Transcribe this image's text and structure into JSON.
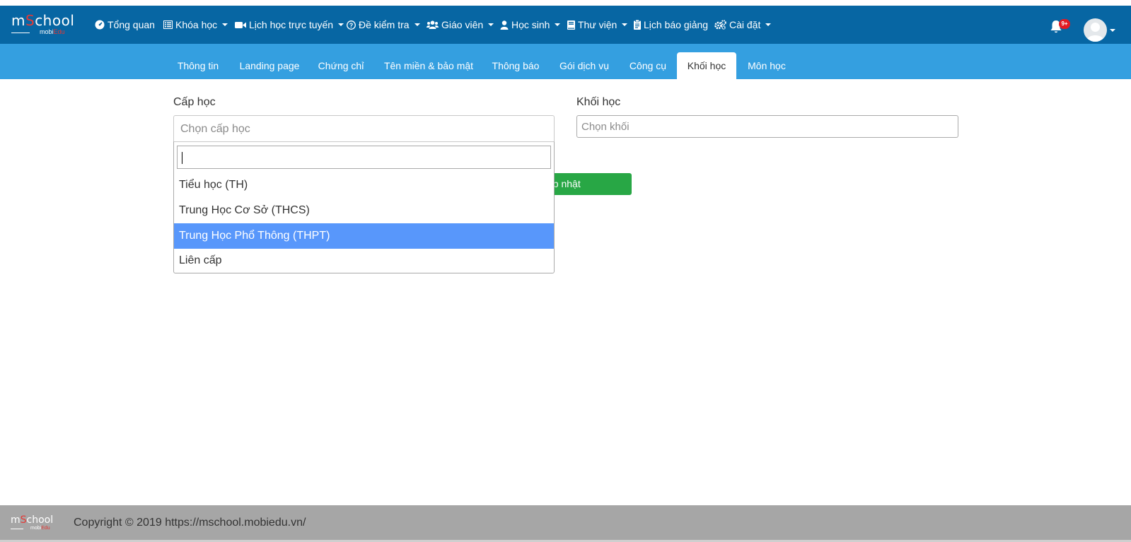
{
  "brand": {
    "logo_main": "mSchool",
    "logo_sub": "mobiEdu"
  },
  "nav": {
    "items": [
      {
        "label": "Tổng quan",
        "icon": "dashboard-icon",
        "dropdown": false
      },
      {
        "label": "Khóa học",
        "icon": "list-icon",
        "dropdown": true
      },
      {
        "label": "Lịch học trực tuyến",
        "icon": "video-icon",
        "dropdown": true
      },
      {
        "label": "Đề kiểm tra",
        "icon": "question-icon",
        "dropdown": true
      },
      {
        "label": "Giáo viên",
        "icon": "users-icon",
        "dropdown": true
      },
      {
        "label": "Học sinh",
        "icon": "user-icon",
        "dropdown": true
      },
      {
        "label": "Thư viện",
        "icon": "book-icon",
        "dropdown": true
      },
      {
        "label": "Lịch báo giảng",
        "icon": "clipboard-icon",
        "dropdown": false
      },
      {
        "label": "Cài đặt",
        "icon": "gears-icon",
        "dropdown": true
      }
    ],
    "notification_badge": "9+"
  },
  "tabs": [
    {
      "label": "Thông tin"
    },
    {
      "label": "Landing page"
    },
    {
      "label": "Chứng chỉ"
    },
    {
      "label": "Tên miền & bảo mật"
    },
    {
      "label": "Thông báo"
    },
    {
      "label": "Gói dịch vụ"
    },
    {
      "label": "Công cụ"
    },
    {
      "label": "Khối học",
      "active": true
    },
    {
      "label": "Môn học"
    }
  ],
  "form": {
    "cap_hoc_label": "Cấp học",
    "cap_hoc_placeholder": "Chọn cấp học",
    "khoi_hoc_label": "Khối học",
    "khoi_hoc_placeholder": "Chọn khối",
    "update_button_visible": "ập nhật"
  },
  "dropdown": {
    "search_value": "",
    "options": [
      {
        "label": "Tiểu học (TH)"
      },
      {
        "label": "Trung Học Cơ Sở (THCS)"
      },
      {
        "label": "Trung Học Phổ Thông (THPT)",
        "highlighted": true
      },
      {
        "label": "Liên cấp"
      }
    ]
  },
  "footer": {
    "copyright": "Copyright © 2019 https://mschool.mobiedu.vn/"
  },
  "colors": {
    "navbar": "#0766a3",
    "subnav": "#349fe0",
    "update_button": "#28a745",
    "highlight": "#5897fb",
    "footer": "#a6a6a6",
    "badge": "#e31b23"
  }
}
